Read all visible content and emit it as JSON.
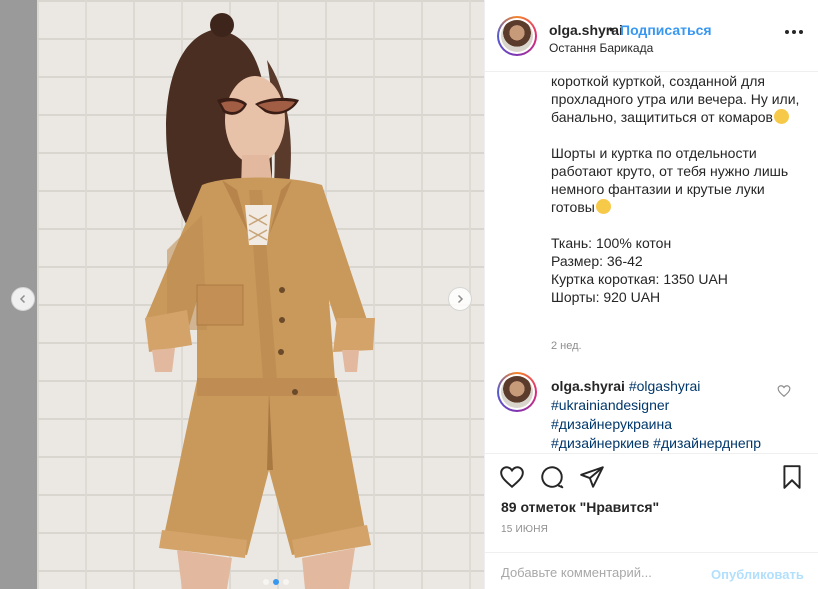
{
  "post": {
    "username": "olga.shyrai",
    "separator": "•",
    "follow_label": "Подписаться",
    "location": "Остання Барикада",
    "caption": {
      "para1": "короткой курткой, созданной для прохладного утра или вечера. Ну или, банально, защититься от комаров",
      "para2": "Шорты и куртка по отдельности работают круто, от тебя нужно лишь немного фантазии и крутые луки готовы",
      "details": [
        "Ткань: 100% котон",
        "Размер: 36-42",
        "Куртка короткая: 1350 UAH",
        "Шорты: 920 UAH"
      ]
    },
    "time_ago": "2 нед.",
    "comment": {
      "username": "olga.shyrai",
      "hashtags": [
        "#olgashyrai",
        "#ukrainiandesigner",
        "#дизайнерукраина",
        "#дизайнеркиев",
        "#дизайнерднепр"
      ]
    },
    "likes": "89 отметок \"Нравится\"",
    "date": "15 ИЮНЯ",
    "add_comment_placeholder": "Добавьте комментарий...",
    "publish_label": "Опубликовать",
    "carousel": {
      "slides": 3,
      "active": 2
    }
  },
  "icons": {
    "more": "more-dots-icon",
    "like": "heart-icon",
    "comment": "comment-icon",
    "share": "paper-plane-icon",
    "save": "bookmark-icon",
    "prev": "chevron-left-icon",
    "next": "chevron-right-icon"
  },
  "colors": {
    "link_blue": "#3897f0",
    "publish_disabled": "#b2dffc",
    "hashtag": "#00376b",
    "text": "#262626",
    "muted": "#8e8e8e",
    "jacket": "#c9995c"
  }
}
